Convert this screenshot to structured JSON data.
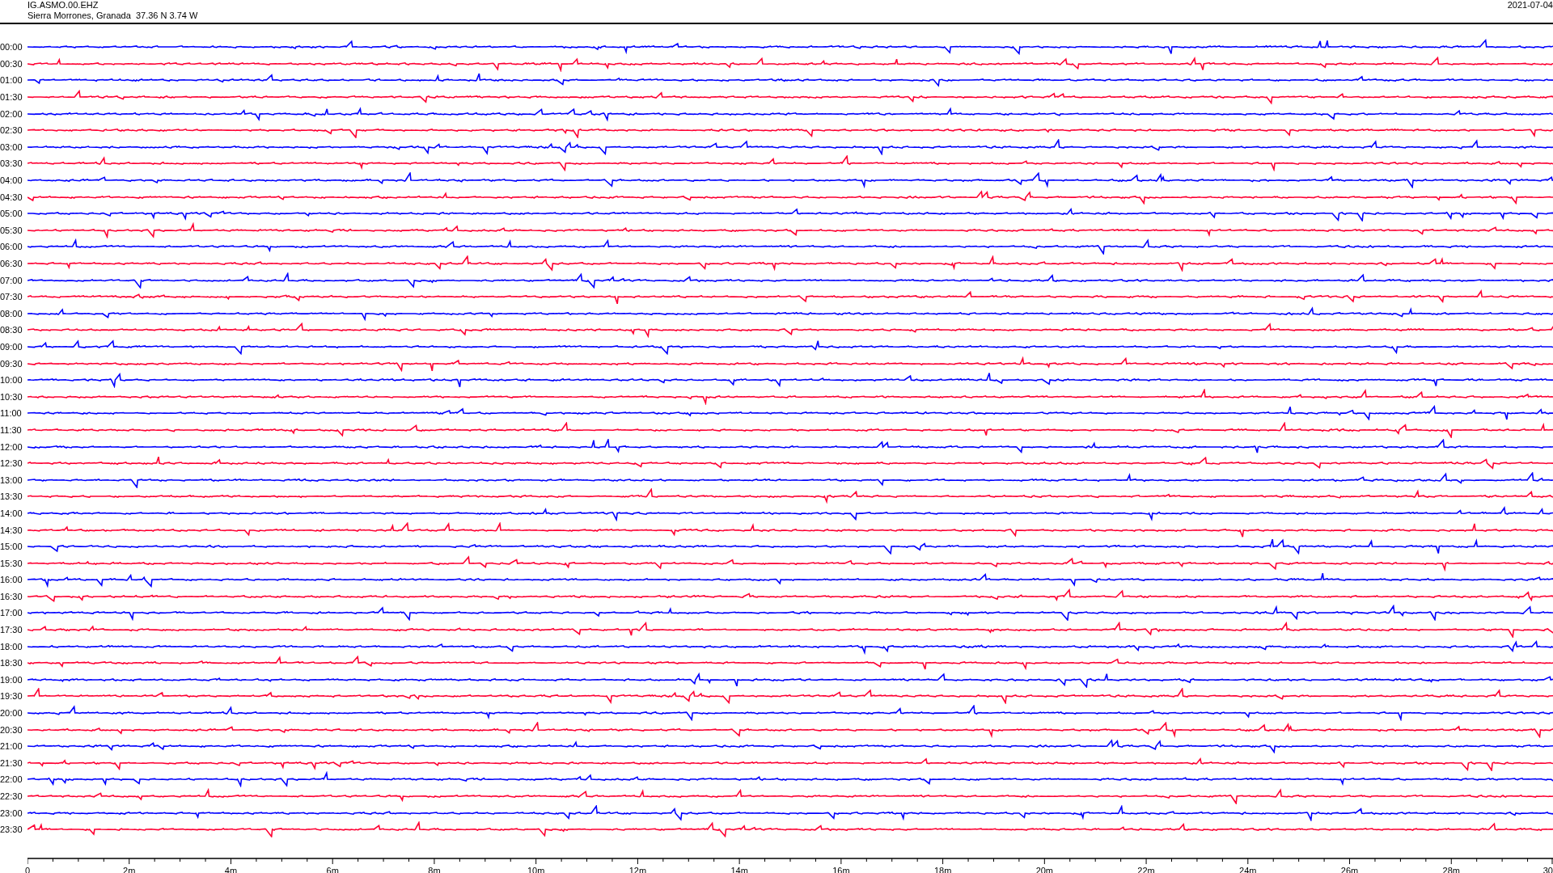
{
  "header": {
    "station": "IG.ASMO.00.EHZ",
    "location": "Sierra Morrones, Granada  37.36 N 3.74 W",
    "date": "2021-07-04"
  },
  "rows": [
    {
      "time": "00:00",
      "color": "#0000ff"
    },
    {
      "time": "00:30",
      "color": "#ff0033"
    },
    {
      "time": "01:00",
      "color": "#0000ff"
    },
    {
      "time": "01:30",
      "color": "#ff0033"
    },
    {
      "time": "02:00",
      "color": "#0000ff"
    },
    {
      "time": "02:30",
      "color": "#ff0033"
    },
    {
      "time": "03:00",
      "color": "#0000ff"
    },
    {
      "time": "03:30",
      "color": "#ff0033"
    },
    {
      "time": "04:00",
      "color": "#0000ff"
    },
    {
      "time": "04:30",
      "color": "#ff0033"
    },
    {
      "time": "05:00",
      "color": "#0000ff"
    },
    {
      "time": "05:30",
      "color": "#ff0033"
    },
    {
      "time": "06:00",
      "color": "#0000ff"
    },
    {
      "time": "06:30",
      "color": "#ff0033"
    },
    {
      "time": "07:00",
      "color": "#0000ff"
    },
    {
      "time": "07:30",
      "color": "#ff0033"
    },
    {
      "time": "08:00",
      "color": "#0000ff"
    },
    {
      "time": "08:30",
      "color": "#ff0033"
    },
    {
      "time": "09:00",
      "color": "#0000ff"
    },
    {
      "time": "09:30",
      "color": "#ff0033"
    },
    {
      "time": "10:00",
      "color": "#0000ff"
    },
    {
      "time": "10:30",
      "color": "#ff0033"
    },
    {
      "time": "11:00",
      "color": "#0000ff"
    },
    {
      "time": "11:30",
      "color": "#ff0033"
    },
    {
      "time": "12:00",
      "color": "#0000ff"
    },
    {
      "time": "12:30",
      "color": "#ff0033"
    },
    {
      "time": "13:00",
      "color": "#0000ff"
    },
    {
      "time": "13:30",
      "color": "#ff0033"
    },
    {
      "time": "14:00",
      "color": "#0000ff"
    },
    {
      "time": "14:30",
      "color": "#ff0033"
    },
    {
      "time": "15:00",
      "color": "#0000ff"
    },
    {
      "time": "15:30",
      "color": "#ff0033"
    },
    {
      "time": "16:00",
      "color": "#0000ff"
    },
    {
      "time": "16:30",
      "color": "#ff0033"
    },
    {
      "time": "17:00",
      "color": "#0000ff"
    },
    {
      "time": "17:30",
      "color": "#ff0033"
    },
    {
      "time": "18:00",
      "color": "#0000ff"
    },
    {
      "time": "18:30",
      "color": "#ff0033"
    },
    {
      "time": "19:00",
      "color": "#0000ff"
    },
    {
      "time": "19:30",
      "color": "#ff0033"
    },
    {
      "time": "20:00",
      "color": "#0000ff"
    },
    {
      "time": "20:30",
      "color": "#ff0033"
    },
    {
      "time": "21:00",
      "color": "#0000ff"
    },
    {
      "time": "21:30",
      "color": "#ff0033"
    },
    {
      "time": "22:00",
      "color": "#0000ff"
    },
    {
      "time": "22:30",
      "color": "#ff0033"
    },
    {
      "time": "23:00",
      "color": "#0000ff"
    },
    {
      "time": "23:30",
      "color": "#ff0033"
    }
  ],
  "x_axis": {
    "labels": [
      "0",
      "2m",
      "4m",
      "6m",
      "8m",
      "10m",
      "12m",
      "14m",
      "16m",
      "18m",
      "20m",
      "22m",
      "24m",
      "26m",
      "28m",
      "30"
    ]
  }
}
